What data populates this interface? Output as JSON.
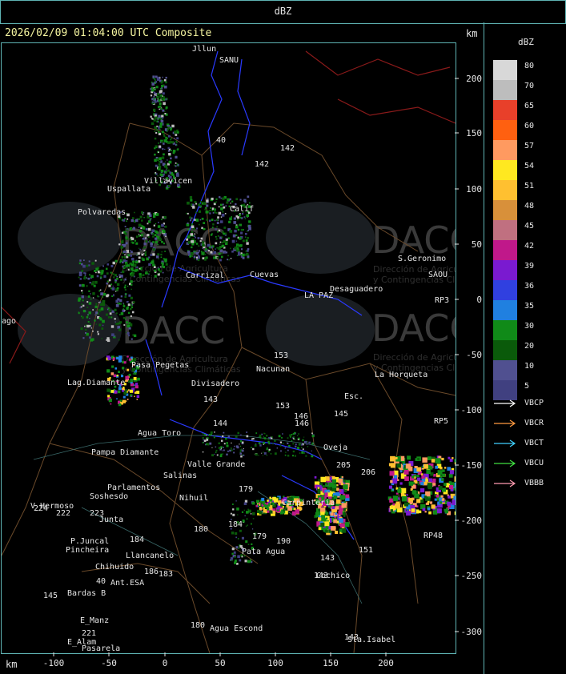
{
  "header": {
    "title": "dBZ",
    "timestamp_line": "2026/02/09 01:04:00 UTC Composite",
    "km_unit_top": "km",
    "km_unit_bottom": "km"
  },
  "axes": {
    "x_ticks": [
      "-100",
      "-50",
      "0",
      "50",
      "100",
      "150",
      "200"
    ],
    "y_ticks": [
      "200",
      "150",
      "100",
      "50",
      "0",
      "-50",
      "-100",
      "-150",
      "-200",
      "-250",
      "-300"
    ]
  },
  "legend": {
    "title": "dBZ",
    "scale": [
      {
        "label": "80",
        "color": "#d8d8d8"
      },
      {
        "label": "70",
        "color": "#bdbdbd"
      },
      {
        "label": "65",
        "color": "#e8402a"
      },
      {
        "label": "60",
        "color": "#ff6010"
      },
      {
        "label": "57",
        "color": "#ff9a60"
      },
      {
        "label": "54",
        "color": "#ffe820"
      },
      {
        "label": "51",
        "color": "#ffc030"
      },
      {
        "label": "48",
        "color": "#d8903a"
      },
      {
        "label": "45",
        "color": "#c07080"
      },
      {
        "label": "42",
        "color": "#c0188a"
      },
      {
        "label": "39",
        "color": "#7a1ad0"
      },
      {
        "label": "36",
        "color": "#3040e0"
      },
      {
        "label": "35",
        "color": "#2080e0"
      },
      {
        "label": "30",
        "color": "#108a18"
      },
      {
        "label": "20",
        "color": "#0a5a0a"
      },
      {
        "label": "10",
        "color": "#505090"
      },
      {
        "label": "5",
        "color": "#404080"
      }
    ],
    "radars": [
      {
        "label": "VBCP",
        "color": "#ffffff"
      },
      {
        "label": "VBCR",
        "color": "#ff9a40"
      },
      {
        "label": "VBCT",
        "color": "#40d0ff"
      },
      {
        "label": "VBCU",
        "color": "#40e040"
      },
      {
        "label": "VBBB",
        "color": "#ff9ab0"
      }
    ]
  },
  "watermarks": [
    {
      "name": "DACC",
      "sub1": "Dirección de Agricultura",
      "sub2": "y Contingencias Climáticas"
    },
    {
      "name": "DACC",
      "sub1": "Dirección de Agricultura",
      "sub2": "y Contingencias Climáticas"
    },
    {
      "name": "DACC",
      "sub1": "Dirección de Agricultura",
      "sub2": "y Contingencias Climáticas"
    },
    {
      "name": "DACC",
      "sub1": "Dirección de Agricultura",
      "sub2": "y Contingencias Climáticas"
    }
  ],
  "places": [
    "Jllun",
    "SANU",
    "Uspallata",
    "Polvaredas",
    "Villavicen",
    "Calif",
    "Carrizal",
    "Cuevas",
    "S.Geronimo",
    "SAOU",
    "Desaguadero",
    "LA PAZ",
    "Pasa Pegetas",
    "Nacunan",
    "La Horqueta",
    "Lag.Diamante",
    "Divisadero",
    "Esc.",
    "Agua Toro",
    "Pampa Diamante",
    "Valle Grande",
    "Salinas",
    "Parlamentos",
    "Soshesdo",
    "Nihuil",
    "V_Hermoso",
    "Junta",
    "P.Juncal",
    "Pincheira",
    "Llancanelo",
    "Chihuido",
    "Ant.ESA",
    "Bardas B",
    "Agua Escond",
    "Pata Agua",
    "Oveja",
    "Carpinteria",
    "Cochico",
    "E_Manz",
    "E_Alam",
    "Pasarela",
    "Sta.Isabel",
    "RP3",
    "RP48",
    "RP5",
    "ago"
  ],
  "road_numbers": [
    "40",
    "142",
    "142",
    "143",
    "143",
    "153",
    "146",
    "153",
    "144",
    "145",
    "180",
    "180",
    "184",
    "184",
    "186",
    "183",
    "190",
    "179",
    "179",
    "151",
    "206",
    "205",
    "222",
    "223",
    "224",
    "221",
    "146",
    "145",
    "143",
    "143",
    "40"
  ]
}
